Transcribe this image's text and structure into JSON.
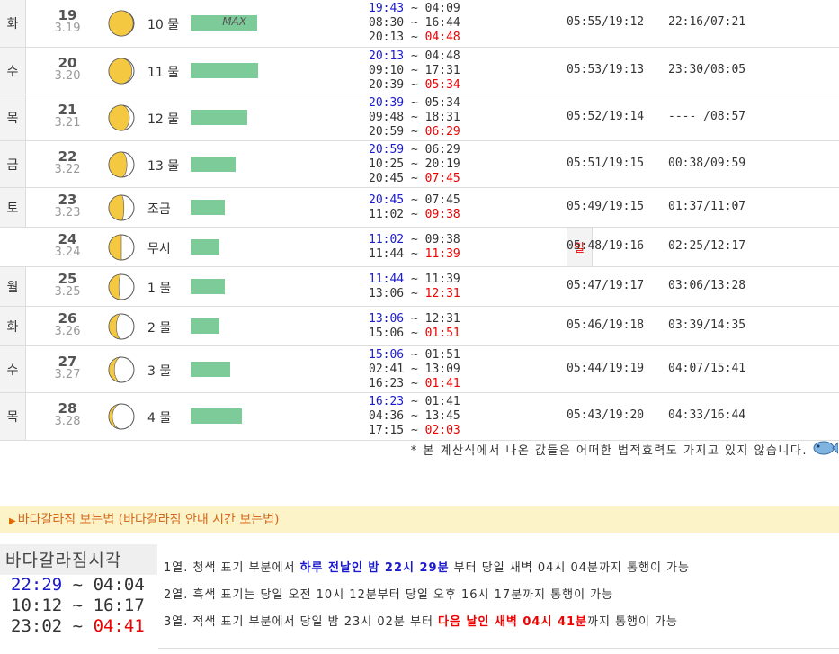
{
  "rows": [
    {
      "dow": "화",
      "day": "19",
      "lunar": "3.19",
      "phase": 0.97,
      "mul": "10 물",
      "bar": 0.98,
      "max": "MAX",
      "t": [
        [
          "19:43",
          "04:09",
          "b",
          "k"
        ],
        [
          "08:30",
          "16:44",
          "k",
          "k"
        ],
        [
          "20:13",
          "04:48",
          "k",
          "r"
        ]
      ],
      "sun": "05:55/19:12",
      "moon": "22:16/07:21"
    },
    {
      "dow": "수",
      "day": "20",
      "lunar": "3.20",
      "phase": 0.92,
      "mul": "11 물",
      "bar": 1.0,
      "max": "",
      "t": [
        [
          "20:13",
          "04:48",
          "b",
          "k"
        ],
        [
          "09:10",
          "17:31",
          "k",
          "k"
        ],
        [
          "20:39",
          "05:34",
          "k",
          "r"
        ]
      ],
      "sun": "05:53/19:13",
      "moon": "23:30/08:05"
    },
    {
      "dow": "목",
      "day": "21",
      "lunar": "3.21",
      "phase": 0.82,
      "mul": "12 물",
      "bar": 0.84,
      "max": "",
      "t": [
        [
          "20:39",
          "05:34",
          "b",
          "k"
        ],
        [
          "09:48",
          "18:31",
          "k",
          "k"
        ],
        [
          "20:59",
          "06:29",
          "k",
          "r"
        ]
      ],
      "sun": "05:52/19:14",
      "moon": "---- /08:57"
    },
    {
      "dow": "금",
      "day": "22",
      "lunar": "3.22",
      "phase": 0.72,
      "mul": "13 물",
      "bar": 0.66,
      "max": "",
      "t": [
        [
          "20:59",
          "06:29",
          "b",
          "k"
        ],
        [
          "10:25",
          "20:19",
          "k",
          "k"
        ],
        [
          "20:45",
          "07:45",
          "k",
          "r"
        ]
      ],
      "sun": "05:51/19:15",
      "moon": "00:38/09:59"
    },
    {
      "dow": "토",
      "day": "23",
      "lunar": "3.23",
      "phase": 0.6,
      "mul": "조금",
      "bar": 0.51,
      "max": "",
      "t": [
        [
          "20:45",
          "07:45",
          "b",
          "k"
        ],
        [
          "11:02",
          "09:38",
          "k",
          "r"
        ]
      ],
      "sun": "05:49/19:15",
      "moon": "01:37/11:07"
    },
    {
      "dow": "일",
      "day": "24",
      "lunar": "3.24",
      "phase": 0.5,
      "mul": "무시",
      "bar": 0.42,
      "max": "",
      "t": [
        [
          "11:02",
          "09:38",
          "b",
          "k"
        ],
        [
          "11:44",
          "11:39",
          "k",
          "r"
        ]
      ],
      "sun": "05:48/19:16",
      "moon": "02:25/12:17"
    },
    {
      "dow": "월",
      "day": "25",
      "lunar": "3.25",
      "phase": 0.4,
      "mul": "1 물",
      "bar": 0.51,
      "max": "",
      "t": [
        [
          "11:44",
          "11:39",
          "b",
          "k"
        ],
        [
          "13:06",
          "12:31",
          "k",
          "r"
        ]
      ],
      "sun": "05:47/19:17",
      "moon": "03:06/13:28"
    },
    {
      "dow": "화",
      "day": "26",
      "lunar": "3.26",
      "phase": 0.3,
      "mul": "2 물",
      "bar": 0.42,
      "max": "",
      "t": [
        [
          "13:06",
          "12:31",
          "b",
          "k"
        ],
        [
          "15:06",
          "01:51",
          "k",
          "r"
        ]
      ],
      "sun": "05:46/19:18",
      "moon": "03:39/14:35"
    },
    {
      "dow": "수",
      "day": "27",
      "lunar": "3.27",
      "phase": 0.22,
      "mul": "3 물",
      "bar": 0.58,
      "max": "",
      "t": [
        [
          "15:06",
          "01:51",
          "b",
          "k"
        ],
        [
          "02:41",
          "13:09",
          "k",
          "k"
        ],
        [
          "16:23",
          "01:41",
          "k",
          "r"
        ]
      ],
      "sun": "05:44/19:19",
      "moon": "04:07/15:41"
    },
    {
      "dow": "목",
      "day": "28",
      "lunar": "3.28",
      "phase": 0.14,
      "mul": "4 물",
      "bar": 0.76,
      "max": "",
      "t": [
        [
          "16:23",
          "01:41",
          "b",
          "k"
        ],
        [
          "04:36",
          "13:45",
          "k",
          "k"
        ],
        [
          "17:15",
          "02:03",
          "k",
          "r"
        ]
      ],
      "sun": "05:43/19:20",
      "moon": "04:33/16:44"
    }
  ],
  "disclaimer": "* 본 계산식에서 나온 값들은 어떠한 법적효력도 가지고 있지 않습니다.",
  "howto_title": "바다갈라짐 보는법 (바다갈라짐 안내 시간 보는법)",
  "guide": {
    "title": "바다갈라짐시각",
    "lines": [
      [
        "22:29",
        "04:04",
        "b",
        "k"
      ],
      [
        "10:12",
        "16:17",
        "k",
        "k"
      ],
      [
        "23:02",
        "04:41",
        "k",
        "r"
      ]
    ],
    "l1a": "1열. 청색 표기 부분에서 ",
    "l1b": "하루 전날인 밤 22시 29분",
    "l1c": " 부터 당일 새벽 04시 04분까지 통행이 가능",
    "l2": "2열. 흑색 표기는 당일 오전 10시 12분부터 당일 오후 16시 17분까지 통행이 가능",
    "l3a": "3열. 적색 표기 부분에서 당일 밤 23시 02분 부터 ",
    "l3b": "다음 날인 새벽 04시 41분",
    "l3c": "까지 통행이 가능"
  },
  "colors": {
    "blue": "#1a1acc",
    "red": "#e00000",
    "bar": "#7dcb98",
    "moon": "#f5c842"
  }
}
